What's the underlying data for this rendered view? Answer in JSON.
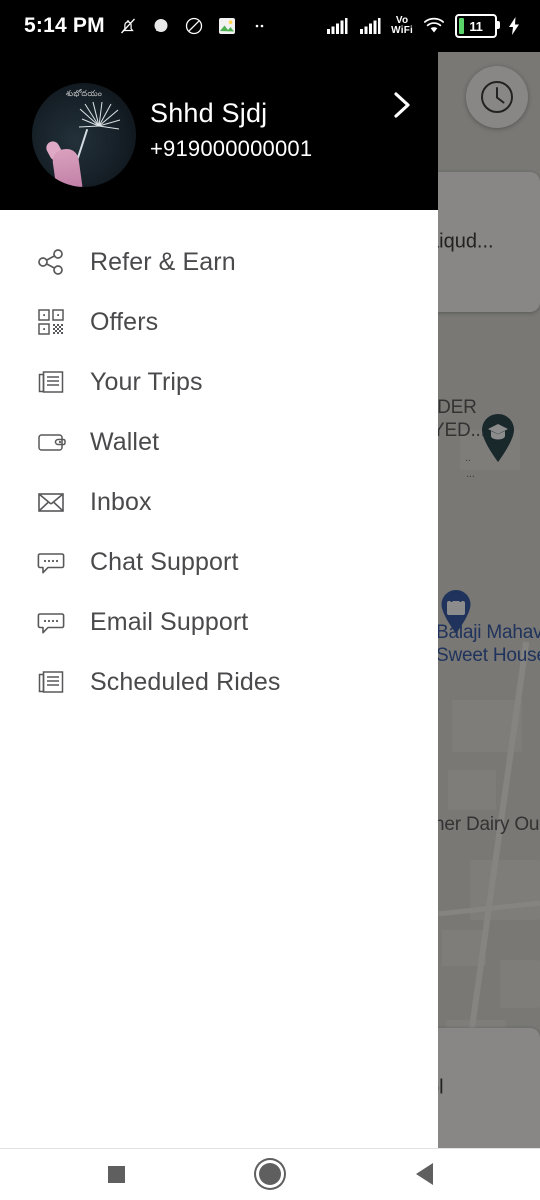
{
  "statusbar": {
    "time": "5:14 PM",
    "left_icons": [
      "bell-off-icon",
      "chat-icon",
      "do-not-disturb-icon",
      "photos-icon",
      "more-dots-icon"
    ],
    "right_icons": [
      "signal-bars-sim1-icon",
      "signal-bars-sim2-icon",
      "volte-wifi-icon",
      "wifi-icon"
    ],
    "volte_top": "Vo",
    "volte_bottom": "WiFi",
    "battery_percent": "11",
    "battery_charging": true,
    "battery_fill_color": "#5ad469",
    "background_color": "#000000",
    "foreground_color": "#ffffff"
  },
  "drawer": {
    "background_color": "#ffffff",
    "header": {
      "background_color": "#000000",
      "avatar_name": "avatar",
      "avatar_caption": "శుభోదయం",
      "name": "Shhd Sjdj",
      "phone": "+919000000001",
      "chevron": "chevron-right-icon"
    },
    "menu_items": [
      {
        "label": "Refer & Earn",
        "icon": "share-icon"
      },
      {
        "label": "Offers",
        "icon": "qr-code-icon"
      },
      {
        "label": "Your Trips",
        "icon": "document-list-icon"
      },
      {
        "label": "Wallet",
        "icon": "wallet-icon"
      },
      {
        "label": "Inbox",
        "icon": "envelope-icon"
      },
      {
        "label": "Chat Support",
        "icon": "chat-bubble-icon"
      },
      {
        "label": "Email Support",
        "icon": "chat-bubble-icon"
      },
      {
        "label": "Scheduled Rides",
        "icon": "document-list-icon"
      }
    ],
    "text_color": "#4a4a4c",
    "icon_color": "#58585a"
  },
  "map": {
    "scrim_color": "rgba(0,0,0,0.45)",
    "schedule_button_icon": "clock-icon",
    "destination_card_text": "aiqud...",
    "bottom_card_text": "ol",
    "labels": [
      {
        "text": "IDER",
        "style": "dark"
      },
      {
        "text": "YED...",
        "style": "dark"
      },
      {
        "text": "Balaji Mahav",
        "style": "blue"
      },
      {
        "text": "Sweet House",
        "style": "blue"
      },
      {
        "text": "her Dairy Ou",
        "style": "dark"
      }
    ],
    "pins": [
      {
        "name": "graduation-cap-pin",
        "color": "#2f4a4f"
      },
      {
        "name": "shopping-bag-pin",
        "color": "#3b5ea8"
      }
    ]
  },
  "navbar": {
    "background_color": "#ffffff",
    "buttons": [
      {
        "name": "recents-button",
        "icon": "square-icon"
      },
      {
        "name": "home-button",
        "icon": "circle-icon"
      },
      {
        "name": "back-button",
        "icon": "triangle-left-icon"
      }
    ]
  }
}
